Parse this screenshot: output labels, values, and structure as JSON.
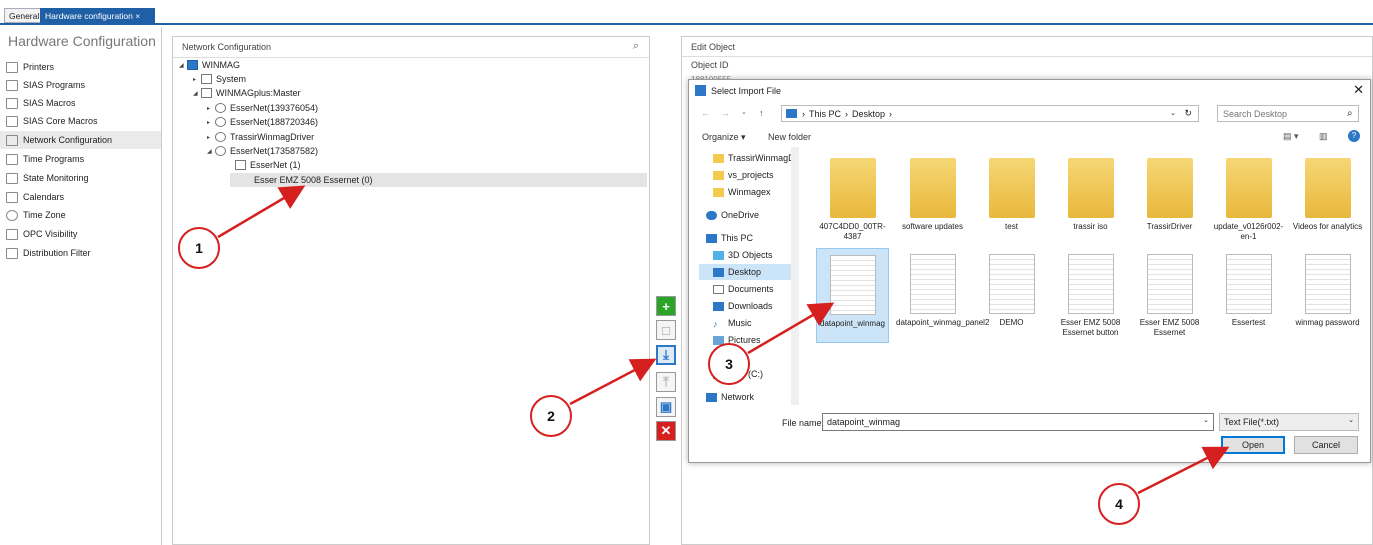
{
  "tabs": [
    "General",
    "Hardware configuration"
  ],
  "tab_close": "×",
  "nav": {
    "title": "Hardware Configuration",
    "items": [
      "Printers",
      "SIAS Programs",
      "SIAS Macros",
      "SIAS Core Macros",
      "Network Configuration",
      "Time Programs",
      "State Monitoring",
      "Calendars",
      "Time Zone",
      "OPC Visibility",
      "Distribution Filter"
    ],
    "selected": "Network Configuration"
  },
  "network": {
    "header": "Network Configuration",
    "tree": [
      {
        "label": "WINMAG"
      },
      {
        "label": "System"
      },
      {
        "label": "WINMAGplus:Master"
      },
      {
        "label": "EsserNet(139376054)"
      },
      {
        "label": "EsserNet(188720346)"
      },
      {
        "label": "TrassirWinmagDriver"
      },
      {
        "label": "EsserNet(173587582)"
      },
      {
        "label": "EsserNet  (1)"
      },
      {
        "label": "Esser EMZ 5008 Essernet  (0)"
      }
    ]
  },
  "edit": {
    "header": "Edit Object",
    "object_id_label": "Object ID",
    "object_id_value": "188100555"
  },
  "dialog": {
    "title": "Select Import File",
    "address": [
      "This PC",
      "Desktop"
    ],
    "search_placeholder": "Search Desktop",
    "organize": "Organize ▾",
    "new_folder": "New folder",
    "sidebar": [
      "TrassirWinmagD",
      "vs_projects",
      "Winmagex",
      "OneDrive",
      "This PC",
      "3D Objects",
      "Desktop",
      "Documents",
      "Downloads",
      "Music",
      "Pictures",
      "Disk (C:)",
      "Network"
    ],
    "files": [
      {
        "name": "407C4DD0_00TR-4387",
        "kind": "folder"
      },
      {
        "name": "software updates",
        "kind": "folder"
      },
      {
        "name": "test",
        "kind": "folder"
      },
      {
        "name": "trassir iso",
        "kind": "folder"
      },
      {
        "name": "TrassirDriver",
        "kind": "folder"
      },
      {
        "name": "update_v0126r002-en-1",
        "kind": "folder"
      },
      {
        "name": "Videos for analytics",
        "kind": "folder"
      },
      {
        "name": "datapoint_winmag",
        "kind": "file"
      },
      {
        "name": "datapoint_winmag_panel2",
        "kind": "file"
      },
      {
        "name": "DEMO",
        "kind": "file"
      },
      {
        "name": "Esser EMZ 5008 Essernet button",
        "kind": "file"
      },
      {
        "name": "Esser EMZ 5008 Essernet",
        "kind": "file"
      },
      {
        "name": "Essertest",
        "kind": "file"
      },
      {
        "name": "winmag password",
        "kind": "file"
      }
    ],
    "filename_label": "File name:",
    "filename_value": "datapoint_winmag",
    "filetype": "Text File(*.txt)",
    "open": "Open",
    "cancel": "Cancel"
  },
  "callouts": [
    "1",
    "2",
    "3",
    "4"
  ],
  "colors": {
    "accent": "#1f5fa6",
    "callout": "#d6201f"
  }
}
